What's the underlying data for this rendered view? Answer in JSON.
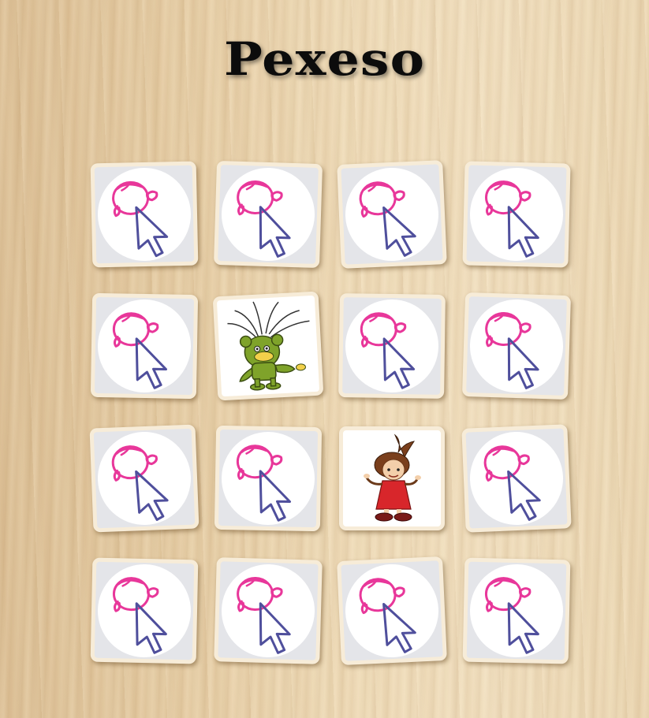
{
  "title": "Pexeso",
  "colors": {
    "card_back_outline_pink": "#e8379a",
    "card_back_cursor_blue": "#4f4f9c",
    "card_frame": "#f7ecd8",
    "card_fill": "#e4e5e9"
  },
  "grid": {
    "rows": 4,
    "columns": 4
  },
  "cards": [
    {
      "state": "hidden",
      "image": "girl-cursor-logo"
    },
    {
      "state": "hidden",
      "image": "girl-cursor-logo"
    },
    {
      "state": "hidden",
      "image": "girl-cursor-logo"
    },
    {
      "state": "hidden",
      "image": "girl-cursor-logo"
    },
    {
      "state": "hidden",
      "image": "girl-cursor-logo"
    },
    {
      "state": "revealed",
      "image": "green-creature-with-antennae"
    },
    {
      "state": "hidden",
      "image": "girl-cursor-logo"
    },
    {
      "state": "hidden",
      "image": "girl-cursor-logo"
    },
    {
      "state": "hidden",
      "image": "girl-cursor-logo"
    },
    {
      "state": "hidden",
      "image": "girl-cursor-logo"
    },
    {
      "state": "revealed",
      "image": "girl-in-red-dress"
    },
    {
      "state": "hidden",
      "image": "girl-cursor-logo"
    },
    {
      "state": "hidden",
      "image": "girl-cursor-logo"
    },
    {
      "state": "hidden",
      "image": "girl-cursor-logo"
    },
    {
      "state": "hidden",
      "image": "girl-cursor-logo"
    },
    {
      "state": "hidden",
      "image": "girl-cursor-logo"
    }
  ]
}
